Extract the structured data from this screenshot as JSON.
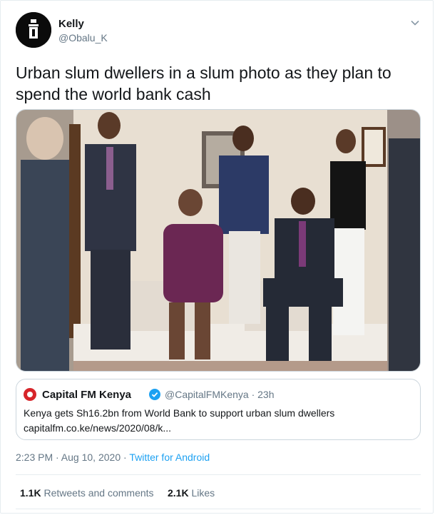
{
  "user": {
    "display_name": "Kelly",
    "handle": "@Obalu_K"
  },
  "tweet": {
    "text": "Urban slum dwellers in a slum photo as they plan to spend the world bank cash",
    "timestamp": "2:23 PM · Aug 10, 2020",
    "separator": " · ",
    "source": "Twitter for Android"
  },
  "quote": {
    "name": "Capital FM Kenya",
    "handle_time": "@CapitalFMKenya · 23h",
    "text": "Kenya gets Sh16.2bn from World Bank to support urban slum dwellers",
    "link": "capitalfm.co.ke/news/2020/08/k..."
  },
  "stats": {
    "retweets_count": "1.1K",
    "retweets_label": "Retweets and comments",
    "likes_count": "2.1K",
    "likes_label": "Likes"
  },
  "colors": {
    "accent": "#1da1f2",
    "text": "#14171a",
    "secondary": "#657786",
    "border": "#e6ecf0",
    "capital_fm_red": "#d7252a"
  }
}
